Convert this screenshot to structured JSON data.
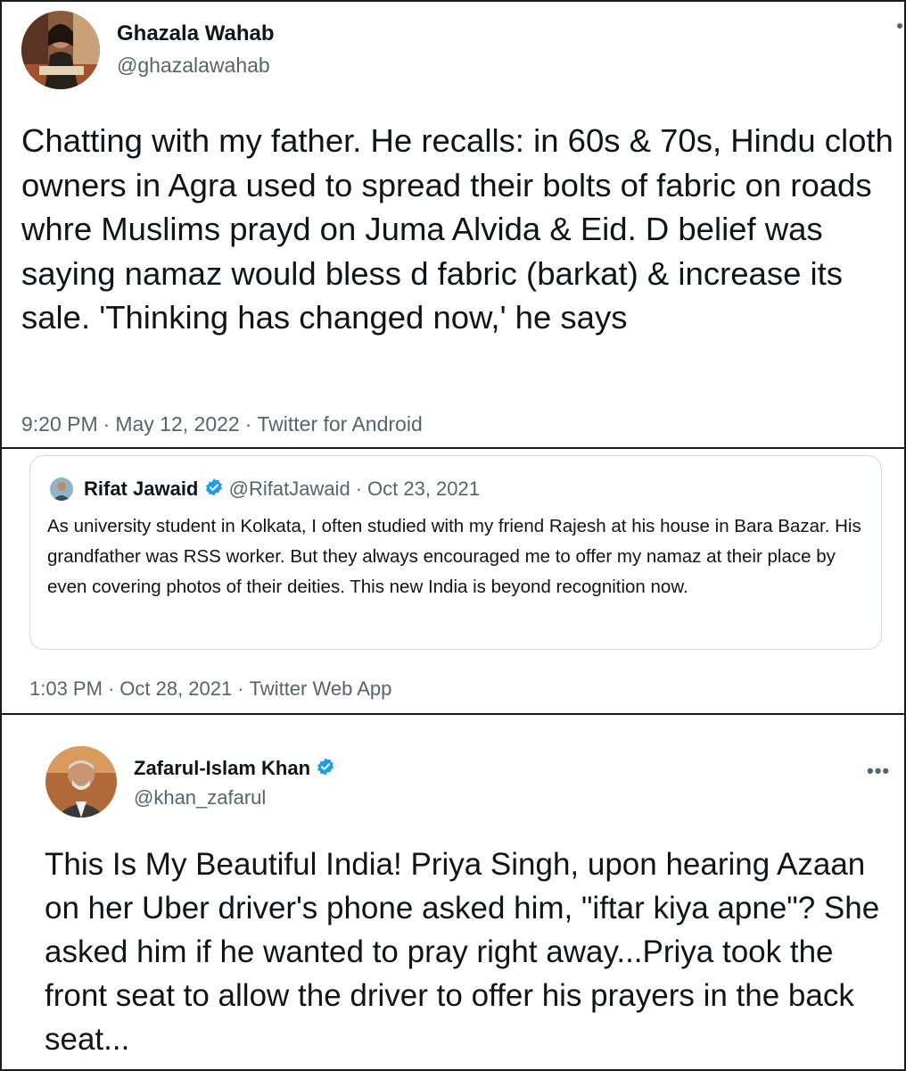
{
  "tweet1": {
    "author_name": "Ghazala Wahab",
    "author_handle": "@ghazalawahab",
    "text": "Chatting with my father. He recalls: in 60s & 70s, Hindu cloth owners in Agra used to spread their bolts of fabric on roads whre Muslims prayd on Juma Alvida & Eid. D belief was saying namaz would bless d fabric (barkat) & increase its sale. 'Thinking has changed now,' he says",
    "time": "9:20 PM",
    "date": "May 12, 2022",
    "source": "Twitter for Android"
  },
  "tweet2": {
    "quoted": {
      "author_name": "Rifat Jawaid",
      "author_handle": "@RifatJawaid",
      "date": "Oct 23, 2021",
      "text": "As university student in Kolkata, I often studied with my friend Rajesh at his house in Bara Bazar. His grandfather was RSS worker. But they always encouraged me to offer my namaz at their place by even covering photos of their deities. This new India is beyond recognition now."
    },
    "time": "1:03 PM",
    "date": "Oct 28, 2021",
    "source": "Twitter Web App"
  },
  "tweet3": {
    "author_name": "Zafarul-Islam Khan",
    "author_handle": "@khan_zafarul",
    "more_label": "•••",
    "text": "This Is My Beautiful India! Priya Singh, upon hearing Azaan on her Uber driver's phone asked him, \"iftar kiya apne\"? She asked him if he wanted to pray right away...Priya took the front seat to allow the driver to offer his prayers in the back seat..."
  },
  "separator": "·",
  "colors": {
    "text": "#0f1419",
    "secondary": "#536471",
    "verified_blue": "#1d9bf0",
    "border": "#cfd9de"
  },
  "icons": {
    "verified": "verified-badge-icon",
    "more": "more-options-icon"
  }
}
